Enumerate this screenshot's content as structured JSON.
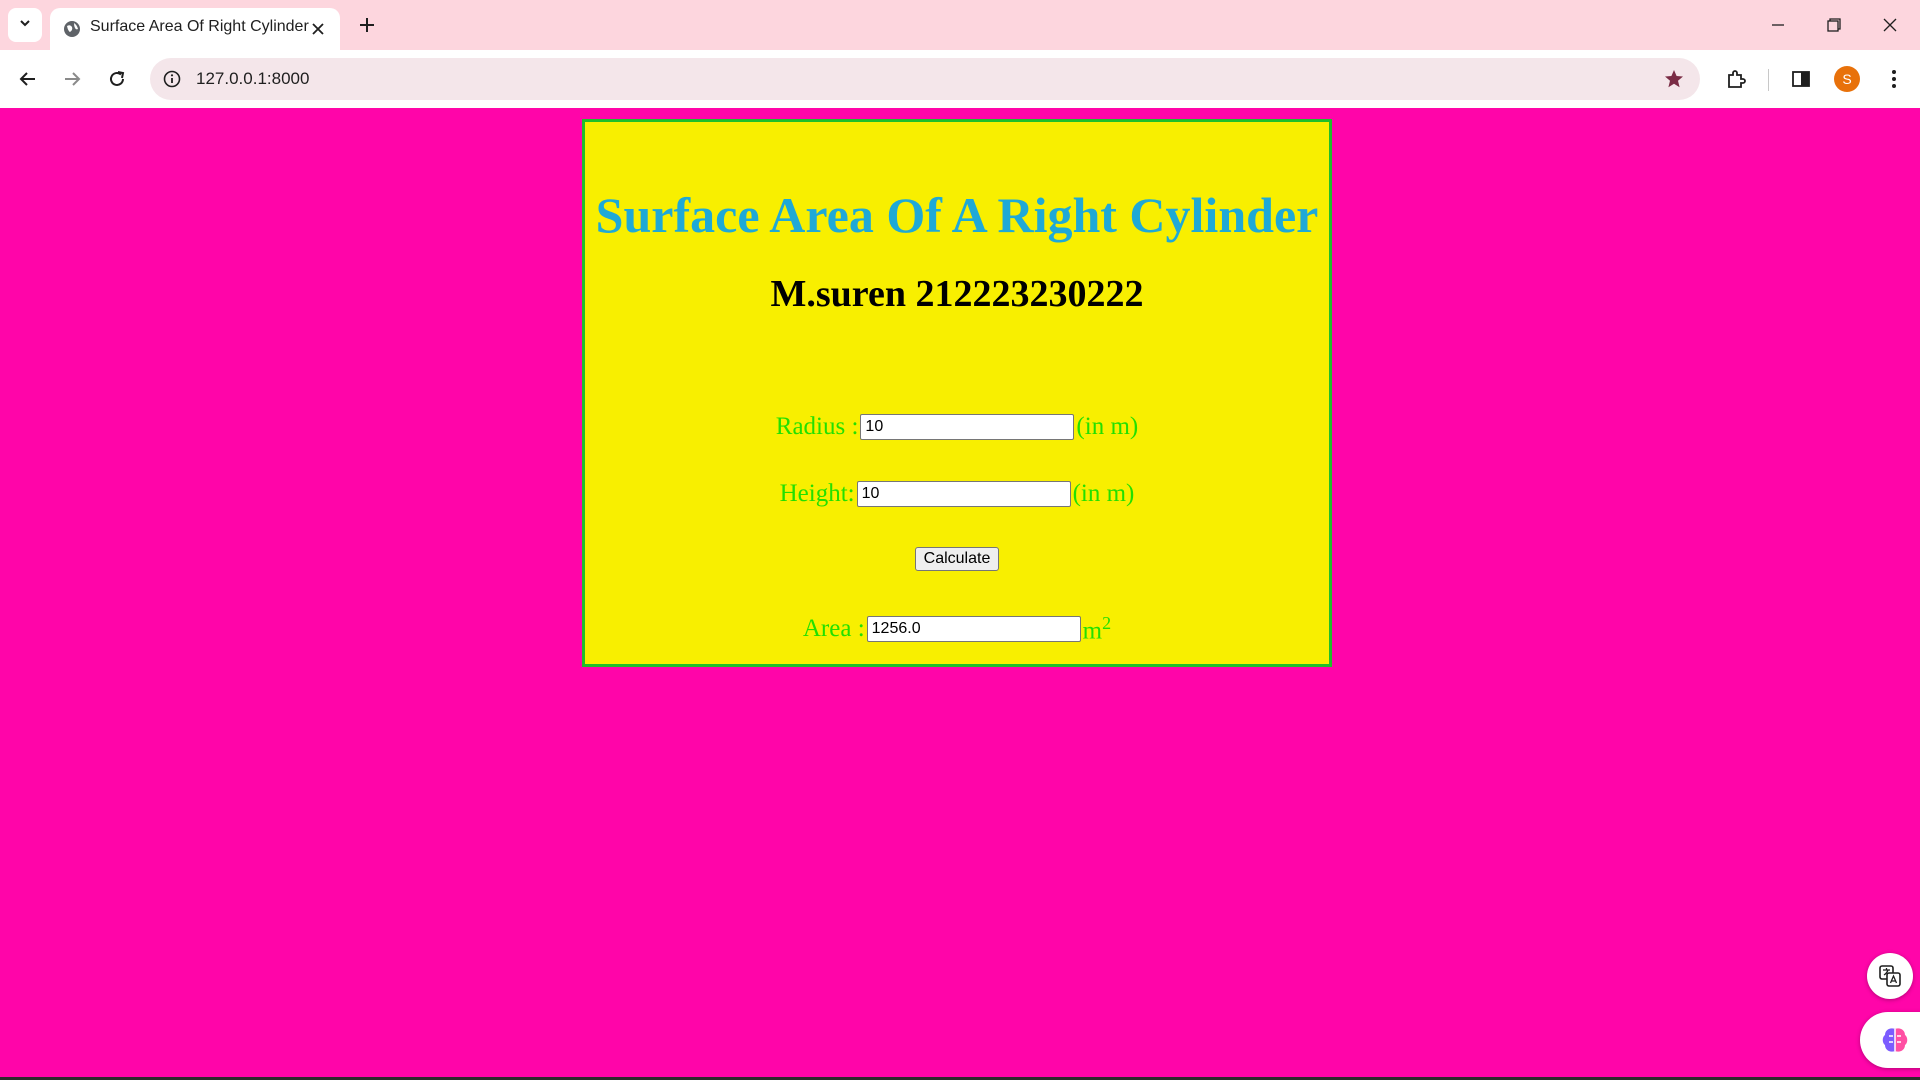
{
  "browser": {
    "tab_title": "Surface Area Of Right Cylinder",
    "url": "127.0.0.1:8000",
    "profile_initial": "S"
  },
  "page": {
    "title": "Surface Area Of A Right Cylinder",
    "subtitle": "M.suren 212223230222",
    "radius": {
      "label": "Radius :",
      "value": "10",
      "unit": "(in m)"
    },
    "height": {
      "label": "Height:",
      "value": "10",
      "unit": "(in m)"
    },
    "calculate_label": "Calculate",
    "area": {
      "label": "Area :",
      "value": "1256.0",
      "unit": "m",
      "unit_sup": "2"
    }
  },
  "colors": {
    "page_background": "#ff05a9",
    "card_background": "#f8ef00",
    "card_border": "#1fbf2a",
    "title": "#1fa9d6",
    "labels": "#22e000"
  }
}
